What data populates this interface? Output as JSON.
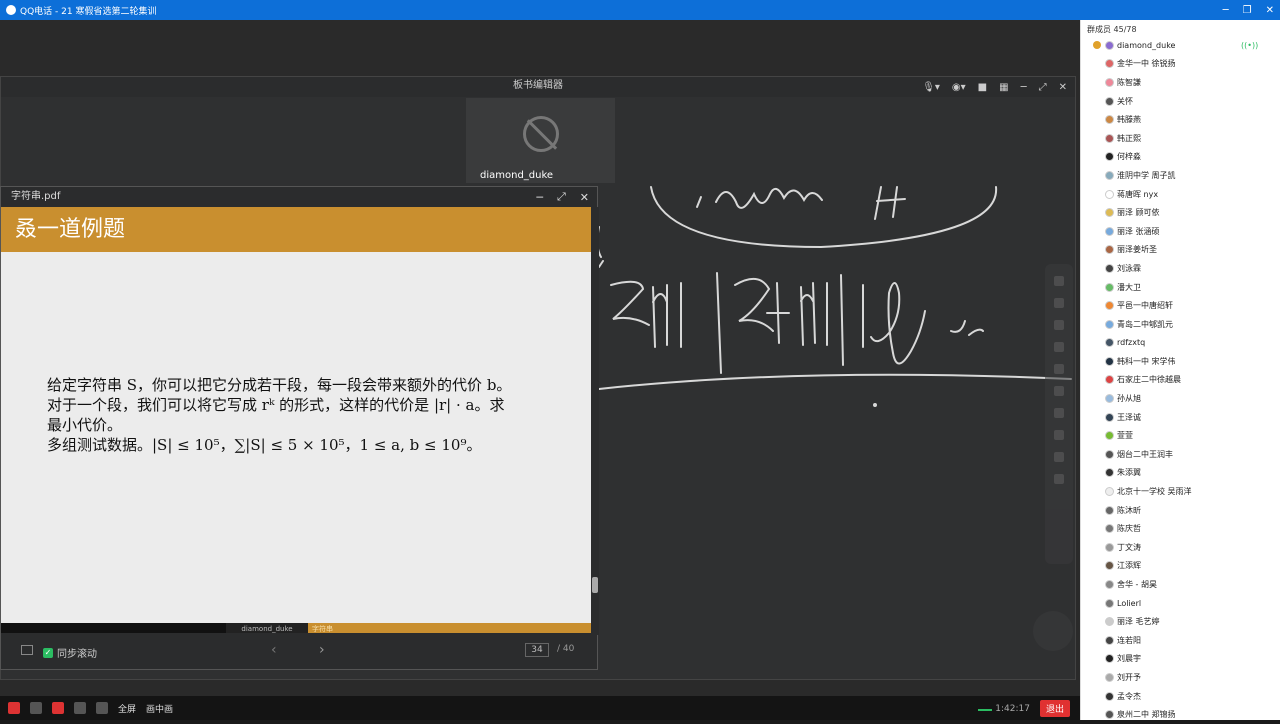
{
  "app": {
    "title": "QQ电话 - 21 寒假省选第二轮集训"
  },
  "whiteboard": {
    "title": "板书编辑器",
    "camera_user": "diamond_duke"
  },
  "pdf": {
    "filename": "字符串.pdf",
    "slide_title": "叒一道例题",
    "body_lines": [
      "给定字符串 S，你可以把它分成若干段，每一段会带来额外的代价 b。",
      "对于一个段，我们可以将它写成 rᵏ 的形式，这样的代价是 |r| · a。求",
      "最小代价。",
      "多组测试数据。|S| ≤ 10⁵，∑|S| ≤ 5 × 10⁵，1 ≤ a, b ≤ 10⁹。"
    ],
    "footer_author": "diamond_duke",
    "footer_topic": "字符串",
    "sync_label": "同步滚动",
    "page_current": "34",
    "page_total": "/ 40"
  },
  "bottombar": {
    "fullscreen": "全屏",
    "pip": "画中画",
    "time": "1:42:17",
    "exit": "退出"
  },
  "members": {
    "header": "群成员 45/78",
    "list": [
      {
        "name": "diamond_duke",
        "color": "#8a6cd0"
      },
      {
        "name": "金华一中 徐锐扬",
        "color": "#d66"
      },
      {
        "name": "陈智謙",
        "color": "#e89"
      },
      {
        "name": "关怀",
        "color": "#555"
      },
      {
        "name": "韩滕燕",
        "color": "#c84"
      },
      {
        "name": "韩正熙",
        "color": "#a55"
      },
      {
        "name": "何梓淼",
        "color": "#222"
      },
      {
        "name": "淮阴中学 周子凯",
        "color": "#8ab"
      },
      {
        "name": "蒋唐晖 nyx",
        "color": "#fff"
      },
      {
        "name": "丽泽 顾可依",
        "color": "#db5"
      },
      {
        "name": "丽泽 张涵硕",
        "color": "#7ad"
      },
      {
        "name": "丽泽姜圻圣",
        "color": "#a64"
      },
      {
        "name": "刘泳霖",
        "color": "#444"
      },
      {
        "name": "潘大卫",
        "color": "#6b6"
      },
      {
        "name": "平邑一中唐绍轩",
        "color": "#e83"
      },
      {
        "name": "青岛二中郇凯元",
        "color": "#7ad"
      },
      {
        "name": "rdfzxtq",
        "color": "#456"
      },
      {
        "name": "韩科一中 宋学伟",
        "color": "#234"
      },
      {
        "name": "石家庄二中徐越晨",
        "color": "#d44"
      },
      {
        "name": "孙从旭",
        "color": "#9bd"
      },
      {
        "name": "王泽诚",
        "color": "#345"
      },
      {
        "name": "萱萱",
        "color": "#7b3"
      },
      {
        "name": "烟台二中王润丰",
        "color": "#555"
      },
      {
        "name": "朱添翼",
        "color": "#333"
      },
      {
        "name": "北京十一学校 吴雨洋",
        "color": "#eee"
      },
      {
        "name": "陈沐昕",
        "color": "#666"
      },
      {
        "name": "陈庆哲",
        "color": "#777"
      },
      {
        "name": "丁文涛",
        "color": "#999"
      },
      {
        "name": "江添辉",
        "color": "#654"
      },
      {
        "name": "舍华 - 胡昊",
        "color": "#888"
      },
      {
        "name": "Lolierl",
        "color": "#777"
      },
      {
        "name": "丽泽 毛艺婷",
        "color": "#ccc"
      },
      {
        "name": "连若阳",
        "color": "#444"
      },
      {
        "name": "刘晨宇",
        "color": "#222"
      },
      {
        "name": "刘开予",
        "color": "#aaa"
      },
      {
        "name": "孟令杰",
        "color": "#333"
      },
      {
        "name": "泉州二中 郑锦扬",
        "color": "#555"
      }
    ]
  }
}
